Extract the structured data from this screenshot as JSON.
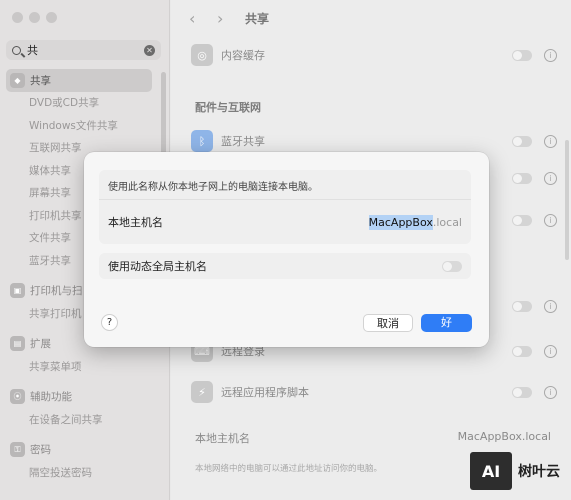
{
  "sidebar": {
    "search": {
      "query": "共"
    },
    "items": [
      {
        "label": "共享",
        "kind": "group",
        "active": true
      },
      {
        "label": "DVD或CD共享",
        "kind": "sub"
      },
      {
        "label": "Windows文件共享",
        "kind": "sub"
      },
      {
        "label": "互联网共享",
        "kind": "sub"
      },
      {
        "label": "媒体共享",
        "kind": "sub"
      },
      {
        "label": "屏幕共享",
        "kind": "sub"
      },
      {
        "label": "打印机共享",
        "kind": "sub"
      },
      {
        "label": "文件共享",
        "kind": "sub"
      },
      {
        "label": "蓝牙共享",
        "kind": "sub"
      },
      {
        "label": "打印机与扫",
        "kind": "group"
      },
      {
        "label": "共享打印机",
        "kind": "sub"
      },
      {
        "label": "扩展",
        "kind": "group"
      },
      {
        "label": "共享菜单项",
        "kind": "sub"
      },
      {
        "label": "辅助功能",
        "kind": "group"
      },
      {
        "label": "在设备之间共享",
        "kind": "sub"
      },
      {
        "label": "密码",
        "kind": "group"
      },
      {
        "label": "隔空投送密码",
        "kind": "sub"
      }
    ]
  },
  "main": {
    "toolbar_title": "共享",
    "content_cache": "内容缓存",
    "section_accessories": "配件与互联网",
    "bluetooth_sharing": "蓝牙共享",
    "remote_login": "远程登录",
    "remote_scripting": "远程应用程序脚本",
    "local_hostname_label": "本地主机名",
    "local_hostname_value": "MacAppBox.local",
    "footnote": "本地网络中的电脑可以通过此地址访问你的电脑。"
  },
  "dialog": {
    "description": "使用此名称从你本地子网上的电脑连接本电脑。",
    "host_label": "本地主机名",
    "host_selected": "MacAppBox",
    "host_suffix": ".local",
    "dynamic_label": "使用动态全局主机名",
    "help": "?",
    "cancel": "取消",
    "ok": "好"
  },
  "watermark": {
    "box": "AI",
    "text": "树叶云"
  },
  "colors": {
    "accent": "#2f7df6",
    "selection": "#b3d2f5"
  }
}
